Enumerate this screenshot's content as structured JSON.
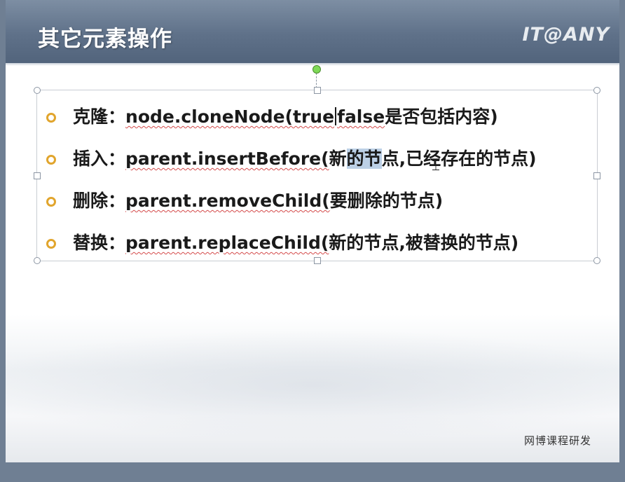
{
  "slide": {
    "title": "其它元素操作",
    "logo": "IT@ANY",
    "footer": "网博课程研发"
  },
  "bullets": [
    {
      "label": "克隆：",
      "code": "node.cloneNode(true",
      "code_after_caret": "false",
      "rest": "是否包括内容)"
    },
    {
      "label": "插入：",
      "code": "parent.insertBefore(",
      "rest_before_sel": "新",
      "selected": "的节",
      "rest": "点,已经存在的节点)"
    },
    {
      "label": "删除：",
      "code": "parent.removeChild(",
      "rest": "要删除的节点)"
    },
    {
      "label": "替换：",
      "code": "parent.replaceChild(",
      "rest": "新的节点,被替换的节点)"
    }
  ],
  "icons": {
    "bullet": "ring-bullet-icon",
    "cursor": "i-beam-cursor-icon"
  },
  "colors": {
    "header": "#5f7189",
    "bullet": "#e1a52d",
    "selection": "#bcd0e6",
    "spellcheck": "#d44b4b"
  }
}
